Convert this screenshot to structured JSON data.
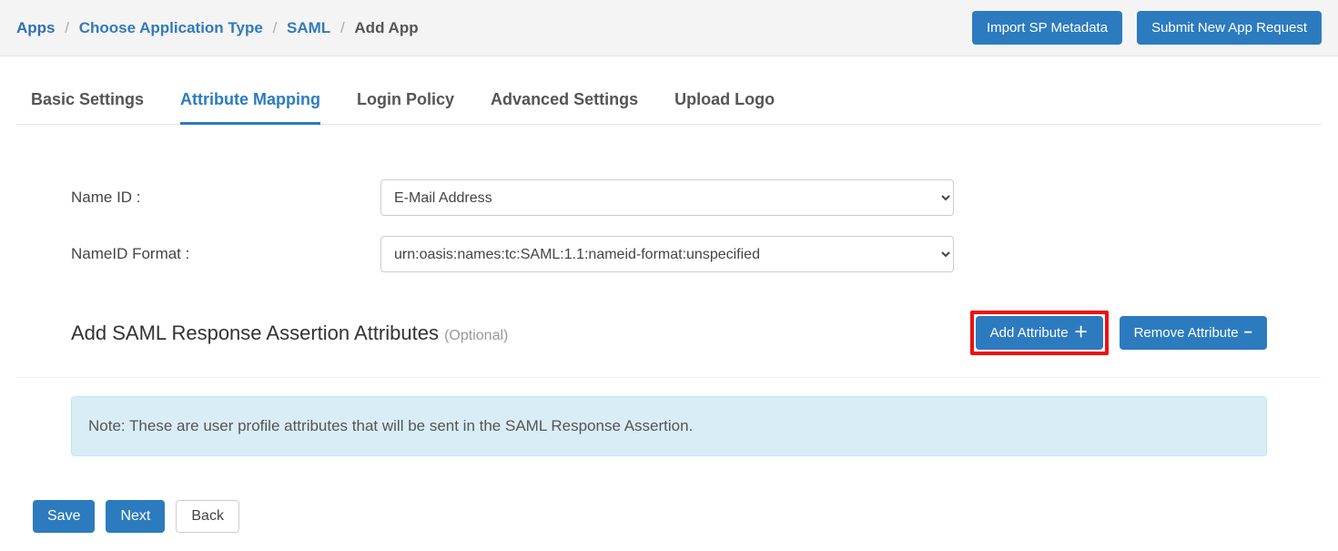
{
  "breadcrumb": {
    "items": [
      "Apps",
      "Choose Application Type",
      "SAML"
    ],
    "current": "Add App"
  },
  "topbar": {
    "import_label": "Import SP Metadata",
    "submit_label": "Submit New App Request"
  },
  "tabs": {
    "items": [
      {
        "label": "Basic Settings",
        "active": false
      },
      {
        "label": "Attribute Mapping",
        "active": true
      },
      {
        "label": "Login Policy",
        "active": false
      },
      {
        "label": "Advanced Settings",
        "active": false
      },
      {
        "label": "Upload Logo",
        "active": false
      }
    ]
  },
  "form": {
    "name_id_label": "Name ID :",
    "name_id_value": "E-Mail Address",
    "nameid_format_label": "NameID Format :",
    "nameid_format_value": "urn:oasis:names:tc:SAML:1.1:nameid-format:unspecified"
  },
  "section": {
    "title": "Add SAML Response Assertion Attributes",
    "optional": "(Optional)",
    "add_label": "Add Attribute",
    "remove_label": "Remove Attribute"
  },
  "note": {
    "text": "Note: These are user profile attributes that will be sent in the SAML Response Assertion."
  },
  "footer": {
    "save": "Save",
    "next": "Next",
    "back": "Back"
  }
}
